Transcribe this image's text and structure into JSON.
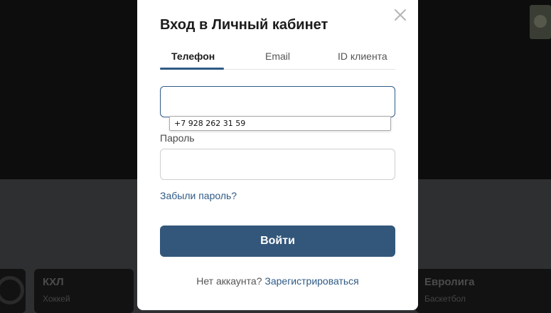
{
  "background": {
    "cards": [
      {
        "title": "КХЛ",
        "subtitle": "Хоккей"
      },
      {
        "title": "Евролига",
        "subtitle": "Баскетбол"
      }
    ]
  },
  "modal": {
    "title": "Вход в Личный кабинет",
    "close_icon": "close-icon",
    "tabs": [
      {
        "label": "Телефон",
        "active": true
      },
      {
        "label": "Email",
        "active": false
      },
      {
        "label": "ID клиента",
        "active": false
      }
    ],
    "phone": {
      "value": "",
      "placeholder": ""
    },
    "autofill_suggestion": "+7 928 262 31 59",
    "password": {
      "label": "Пароль",
      "value": "",
      "placeholder": ""
    },
    "forgot_link": "Забыли пароль?",
    "submit_label": "Войти",
    "footer": {
      "text": "Нет аккаунта?",
      "link": "Зарегистрироваться"
    }
  },
  "colors": {
    "accent": "#2f5a86",
    "button": "#33577b",
    "overlay": "#0d0d0d"
  }
}
